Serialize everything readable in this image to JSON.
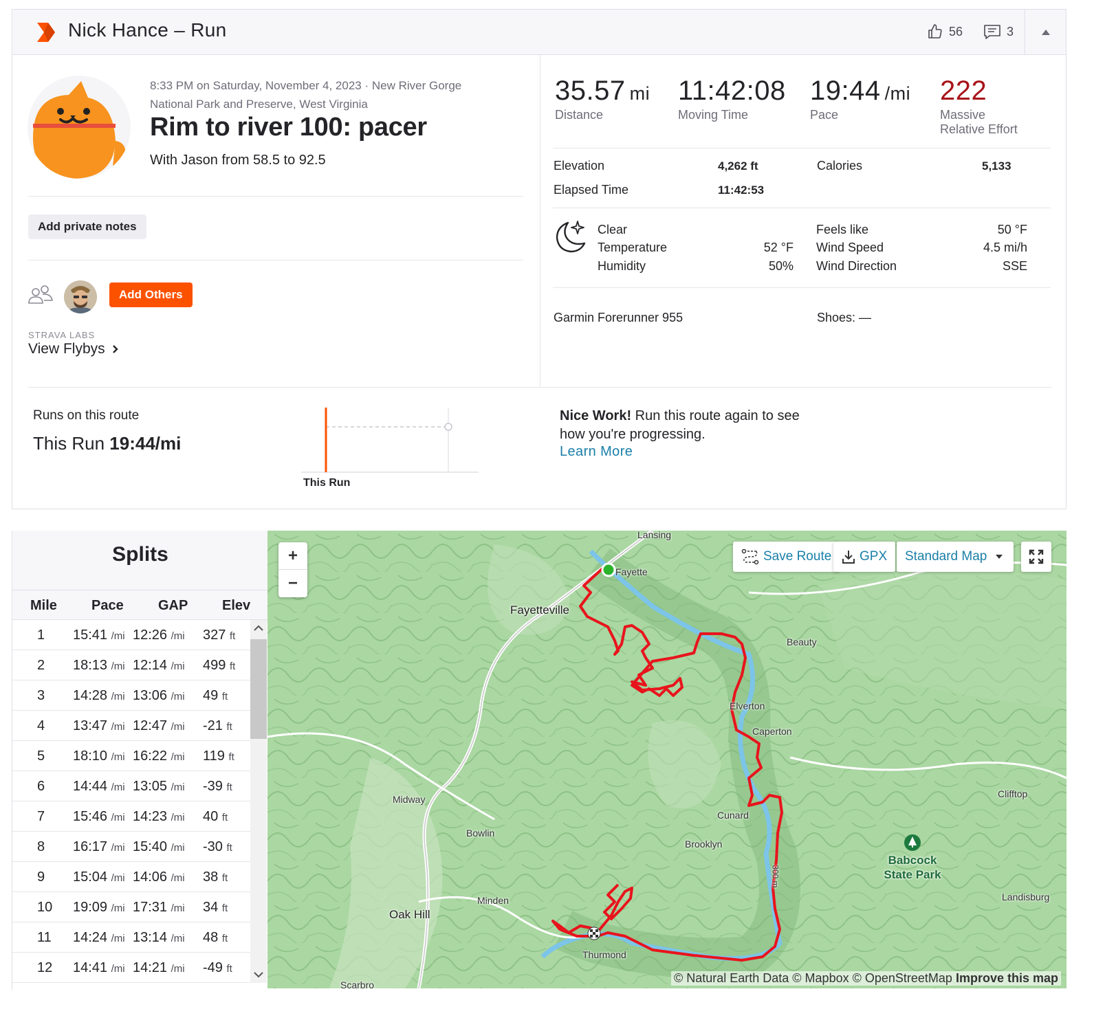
{
  "header": {
    "title": "Nick Hance – Run",
    "kudos_count": "56",
    "comments_count": "3"
  },
  "activity": {
    "meta": "8:33 PM on Saturday, November 4, 2023 · New River Gorge National Park and Preserve, West Virginia",
    "title": "Rim to river 100: pacer",
    "description": "With Jason from 58.5 to 92.5",
    "notes_button": "Add private notes",
    "add_others_button": "Add Others",
    "labs_label": "STRAVA LABS",
    "flybys_link": "View Flybys"
  },
  "stats": {
    "distance": {
      "value": "35.57",
      "unit": "mi",
      "label": "Distance"
    },
    "moving_time": {
      "value": "11:42:08",
      "label": "Moving Time"
    },
    "pace": {
      "value": "19:44",
      "unit": "/mi",
      "label": "Pace"
    },
    "effort": {
      "value": "222",
      "label_1": "Massive",
      "label_2": "Relative Effort"
    },
    "elevation_label": "Elevation",
    "elevation_value": "4,262 ft",
    "calories_label": "Calories",
    "calories_value": "5,133",
    "elapsed_label": "Elapsed Time",
    "elapsed_value": "11:42:53"
  },
  "weather": {
    "condition": "Clear",
    "temperature_label": "Temperature",
    "temperature_value": "52 °F",
    "humidity_label": "Humidity",
    "humidity_value": "50%",
    "feels_like_label": "Feels like",
    "feels_like_value": "50 °F",
    "wind_speed_label": "Wind Speed",
    "wind_speed_value": "4.5 mi/h",
    "wind_direction_label": "Wind Direction",
    "wind_direction_value": "SSE"
  },
  "gear": {
    "device": "Garmin Forerunner 955",
    "shoes": "Shoes: —"
  },
  "route": {
    "label": "Runs on this route",
    "this_run_prefix": "This Run",
    "this_run_pace": "19:44/mi",
    "chart_label": "This Run",
    "nice_work_bold": "Nice Work!",
    "nice_work_text": "Run this route again to see how you're progressing.",
    "learn_more": "Learn More"
  },
  "splits": {
    "title": "Splits",
    "columns": [
      "Mile",
      "Pace",
      "GAP",
      "Elev"
    ],
    "pace_unit": "/mi",
    "elev_unit": "ft",
    "rows": [
      {
        "mile": "1",
        "pace": "15:41",
        "gap": "12:26",
        "elev": "327"
      },
      {
        "mile": "2",
        "pace": "18:13",
        "gap": "12:14",
        "elev": "499"
      },
      {
        "mile": "3",
        "pace": "14:28",
        "gap": "13:06",
        "elev": "49"
      },
      {
        "mile": "4",
        "pace": "13:47",
        "gap": "12:47",
        "elev": "-21"
      },
      {
        "mile": "5",
        "pace": "18:10",
        "gap": "16:22",
        "elev": "119"
      },
      {
        "mile": "6",
        "pace": "14:44",
        "gap": "13:05",
        "elev": "-39"
      },
      {
        "mile": "7",
        "pace": "15:46",
        "gap": "14:23",
        "elev": "40"
      },
      {
        "mile": "8",
        "pace": "16:17",
        "gap": "15:40",
        "elev": "-30"
      },
      {
        "mile": "9",
        "pace": "15:04",
        "gap": "14:06",
        "elev": "38"
      },
      {
        "mile": "10",
        "pace": "19:09",
        "gap": "17:31",
        "elev": "34"
      },
      {
        "mile": "11",
        "pace": "14:24",
        "gap": "13:14",
        "elev": "48"
      },
      {
        "mile": "12",
        "pace": "14:41",
        "gap": "14:21",
        "elev": "-49"
      }
    ]
  },
  "map": {
    "zoom_in": "+",
    "zoom_out": "−",
    "save_route": "Save Route",
    "gpx": "GPX",
    "map_style": "Standard Map",
    "places": {
      "lansing": "Lansing",
      "fayette": "Fayette",
      "fayetteville": "Fayetteville",
      "beauty": "Beauty",
      "elverton": "Elverton",
      "caperton": "Caperton",
      "midway": "Midway",
      "bowlin": "Bowlin",
      "cunard": "Cunard",
      "brooklyn": "Brooklyn",
      "clifftop": "Clifftop",
      "park_1": "Babcock",
      "park_2": "State Park",
      "minden": "Minden",
      "oak_hill": "Oak Hill",
      "landisburg": "Landisburg",
      "thurmond": "Thurmond",
      "scarbro": "Scarbro",
      "contour": "300 m"
    },
    "attribution": "© Natural Earth Data © Mapbox © OpenStreetMap",
    "improve": "Improve this map"
  },
  "colors": {
    "brand_orange": "#fc5200",
    "effort_red": "#a8131a",
    "link_blue": "#1a7fa8",
    "route_red": "#e8141c"
  }
}
